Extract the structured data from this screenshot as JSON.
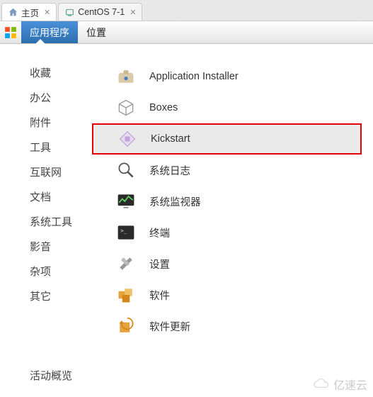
{
  "tabs": [
    {
      "label": "主页",
      "icon": "home-icon"
    },
    {
      "label": "CentOS 7-1",
      "icon": "vm-icon"
    }
  ],
  "menubar": {
    "items": [
      {
        "label": "应用程序",
        "active": true
      },
      {
        "label": "位置",
        "active": false
      }
    ]
  },
  "categories": [
    "收藏",
    "办公",
    "附件",
    "工具",
    "互联网",
    "文档",
    "系统工具",
    "影音",
    "杂项",
    "其它"
  ],
  "overview_label": "活动概览",
  "apps": [
    {
      "label": "Application Installer",
      "icon": "app-installer-icon"
    },
    {
      "label": "Boxes",
      "icon": "boxes-icon"
    },
    {
      "label": "Kickstart",
      "icon": "kickstart-icon",
      "highlight": true
    },
    {
      "label": "系统日志",
      "icon": "logs-icon"
    },
    {
      "label": "系统监视器",
      "icon": "monitor-icon"
    },
    {
      "label": "终端",
      "icon": "terminal-icon"
    },
    {
      "label": "设置",
      "icon": "settings-icon"
    },
    {
      "label": "软件",
      "icon": "software-icon"
    },
    {
      "label": "软件更新",
      "icon": "update-icon"
    }
  ],
  "watermark": "亿速云"
}
